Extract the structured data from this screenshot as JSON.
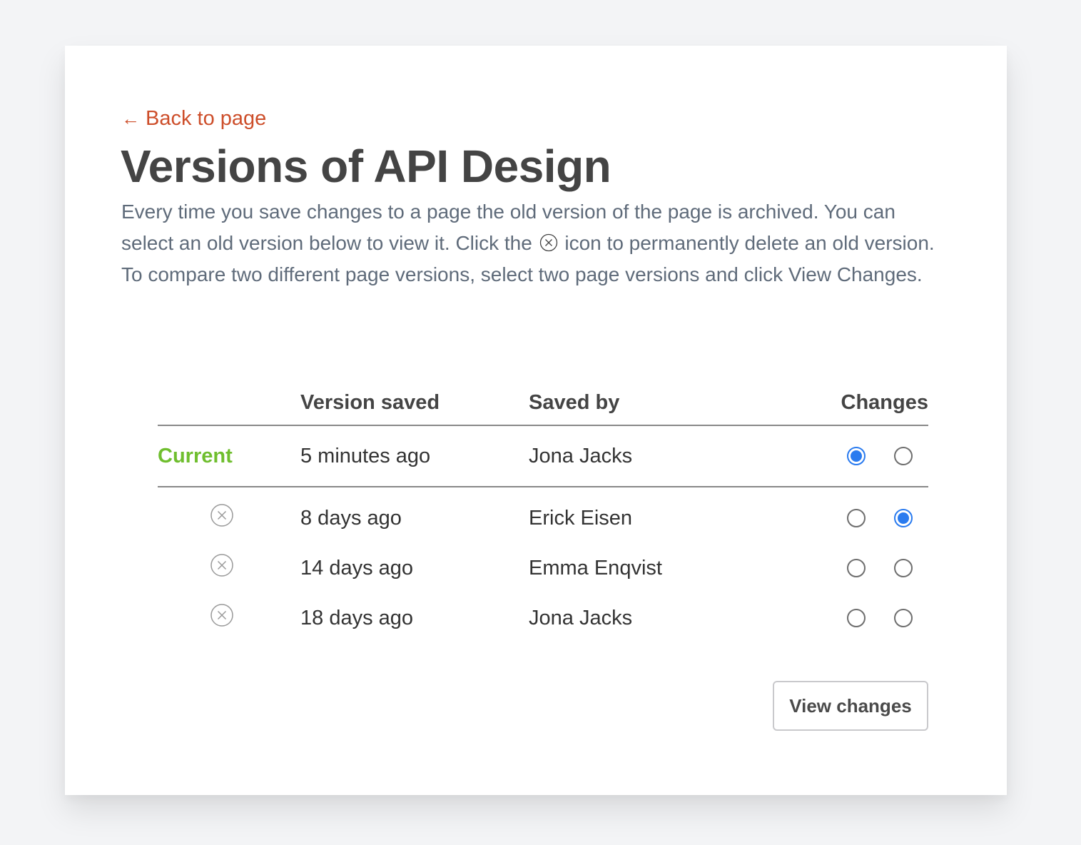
{
  "back_link": {
    "arrow": "←",
    "label": "Back to page"
  },
  "page": {
    "title": "Versions of API Design",
    "intro_before_icon": "Every time you save changes to a page the old version of the page is archived. You can select an old version below to view it. Click the",
    "intro_after_icon": "icon to permanently delete an old version. To compare two different page versions, select two page versions and click View Changes."
  },
  "table": {
    "headers": {
      "status": "",
      "version_saved": "Version saved",
      "saved_by": "Saved by",
      "changes": "Changes"
    },
    "current": {
      "label": "Current",
      "version_saved": "5 minutes ago",
      "saved_by": "Jona Jacks",
      "compare_from": true,
      "compare_to": false
    },
    "rows": [
      {
        "version_saved": "8 days ago",
        "saved_by": "Erick Eisen",
        "compare_from": false,
        "compare_to": true
      },
      {
        "version_saved": "14 days ago",
        "saved_by": "Emma Enqvist",
        "compare_from": false,
        "compare_to": false
      },
      {
        "version_saved": "18 days ago",
        "saved_by": "Jona Jacks",
        "compare_from": false,
        "compare_to": false
      }
    ]
  },
  "actions": {
    "view_changes_label": "View changes"
  },
  "colors": {
    "link": "#cd4e2a",
    "title": "#444444",
    "current": "#6fbe2e",
    "radio_selected": "#2a7bef"
  }
}
